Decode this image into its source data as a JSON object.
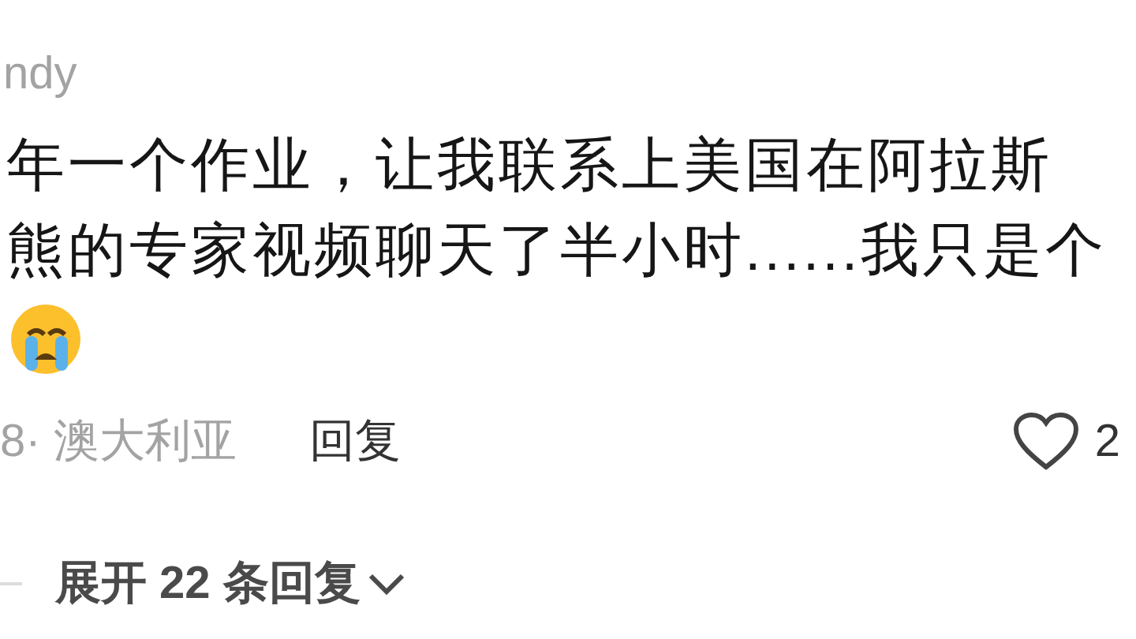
{
  "comment": {
    "author": "ndy",
    "lines": [
      "年一个作业，让我联系上美国在阿拉斯",
      "熊的专家视频聊天了半小时......我只是个"
    ],
    "meta": "8· 澳大利亚",
    "reply": "回复",
    "likes": "2",
    "liked": false
  },
  "expand": {
    "label": "展开 22 条回复"
  }
}
